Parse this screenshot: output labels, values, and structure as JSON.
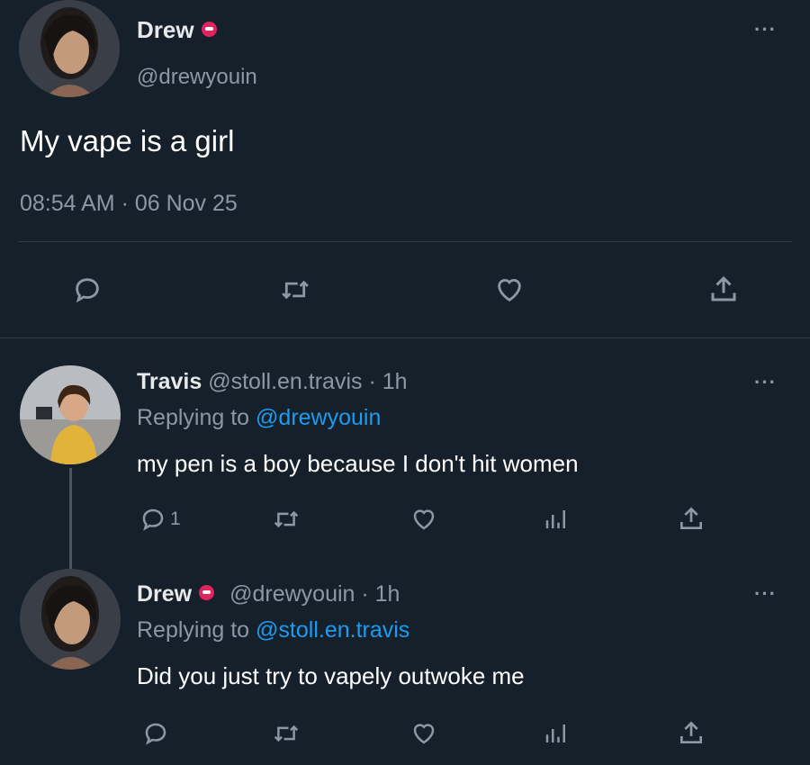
{
  "main_tweet": {
    "author_name": "Drew",
    "handle": "@drewyouin",
    "text": "My vape is a girl",
    "timestamp": "08:54 AM · 06 Nov 25",
    "actions": [
      "reply-icon",
      "retweet-icon",
      "like-icon",
      "share-icon"
    ]
  },
  "replies": [
    {
      "author_name": "Travis",
      "handle_time": "@stoll.en.travis · 1h",
      "replying_prefix": "Replying to",
      "replying_to": "@drewyouin",
      "text": "my pen is a boy because I don't hit women",
      "reply_count": "1"
    },
    {
      "author_name": "Drew",
      "handle_time": "@drewyouin · 1h",
      "replying_prefix": "Replying to",
      "replying_to": "@stoll.en.travis",
      "text": "Did you just try to vapely outwoke me",
      "reply_count": ""
    }
  ],
  "colors": {
    "background": "#15202b",
    "accent": "#1d9bf0",
    "badge": "#e0245e",
    "muted": "#8b98a5"
  }
}
